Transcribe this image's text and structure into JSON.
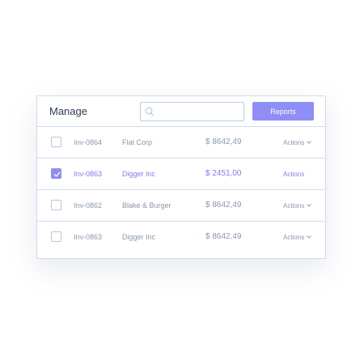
{
  "header": {
    "title": "Manage",
    "search_value": "",
    "search_placeholder": "",
    "reports_label": "Reports"
  },
  "rows": [
    {
      "id": "Inv-0864",
      "company": "Flat Corp",
      "amount": "$ 8642,49",
      "actions": "Actions",
      "checked": false,
      "has_chevron": true
    },
    {
      "id": "Inv-0863",
      "company": "Digger Inc",
      "amount": "$ 2451,00",
      "actions": "Actions",
      "checked": true,
      "has_chevron": false
    },
    {
      "id": "Inv-0862",
      "company": "Blake & Burger",
      "amount": "$ 8642,49",
      "actions": "Actions",
      "checked": false,
      "has_chevron": true
    },
    {
      "id": "Inv-0863",
      "company": "Digger Inc",
      "amount": "$ 8642,49",
      "actions": "Actions",
      "checked": false,
      "has_chevron": true
    }
  ],
  "colors": {
    "accent": "#8f8ef7",
    "border": "#cfdceb",
    "text_dark": "#2b3a55",
    "text_muted": "#8a97aa"
  },
  "icons": {
    "search": "search-icon",
    "check": "check-icon",
    "chevron": "chevron-down-icon"
  }
}
